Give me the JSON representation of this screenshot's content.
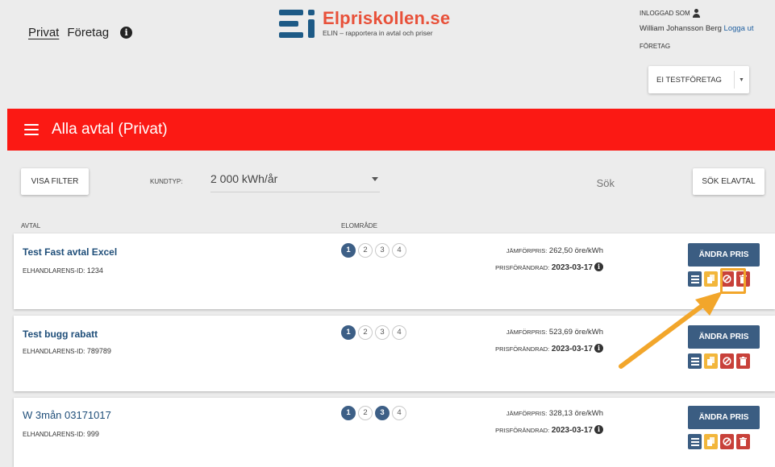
{
  "header": {
    "nav": {
      "privat": "Privat",
      "foretag": "Företag"
    },
    "logo": {
      "title": "Elpriskollen.se",
      "subtitle": "ELIN – rapportera in avtal och priser"
    },
    "user": {
      "logged_in_label": "INLOGGAD SOM",
      "name": "William Johansson Berg",
      "logout": "Logga ut",
      "company_label": "FÖRETAG",
      "company_value": "EI TESTFÖRETAG"
    }
  },
  "titlebar": {
    "title": "Alla avtal (Privat)"
  },
  "filters": {
    "show_filter": "VISA FILTER",
    "kundtyp_label": "KUNDTYP:",
    "kundtyp_value": "2 000 kWh/år",
    "search_placeholder": "Sök",
    "search_button": "SÖK ELAVTAL"
  },
  "columns": {
    "avtal": "AVTAL",
    "elomrade": "ELOMRÅDE"
  },
  "agreements": [
    {
      "name": "Test Fast avtal Excel",
      "id_label": "ELHANDLARENS-ID:",
      "id": "1234",
      "areas": [
        "1",
        "2",
        "3",
        "4"
      ],
      "active_areas": [
        "1"
      ],
      "price_label": "JÄMFÖRPRIS:",
      "price": "262,50 öre/kWh",
      "changed_label": "PRISFÖRÄNDRAD:",
      "changed": "2023-03-17",
      "button": "ÄNDRA PRIS"
    },
    {
      "name": "Test bugg rabatt",
      "id_label": "ELHANDLARENS-ID:",
      "id": "789789",
      "areas": [
        "1",
        "2",
        "3",
        "4"
      ],
      "active_areas": [
        "1"
      ],
      "price_label": "JÄMFÖRPRIS:",
      "price": "523,69 öre/kWh",
      "changed_label": "PRISFÖRÄNDRAD:",
      "changed": "2023-03-17",
      "button": "ÄNDRA PRIS"
    },
    {
      "name": "W 3mån 03171017",
      "id_label": "ELHANDLARENS-ID:",
      "id": "999",
      "areas": [
        "1",
        "2",
        "3",
        "4"
      ],
      "active_areas": [
        "1",
        "3"
      ],
      "price_label": "JÄMFÖRPRIS:",
      "price": "328,13 öre/kWh",
      "changed_label": "PRISFÖRÄNDRAD:",
      "changed": "2023-03-17",
      "button": "ÄNDRA PRIS"
    }
  ],
  "colors": {
    "brand_red": "#fb1914",
    "primary_blue": "#3b5d82",
    "copy_yellow": "#f2b63b",
    "danger_red": "#c8413a",
    "arrow_orange": "#f2a62b"
  },
  "icons": [
    "info-icon",
    "user-icon",
    "hamburger-icon",
    "list-icon",
    "copy-icon",
    "block-icon",
    "trash-icon",
    "arrow-annotation"
  ]
}
